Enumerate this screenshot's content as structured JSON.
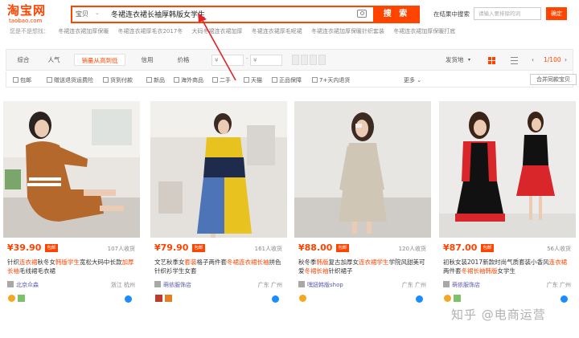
{
  "header": {
    "logo_cn": "淘宝网",
    "logo_en": "taobao.com",
    "search_scope": "宝贝",
    "search_query": "冬裙连衣裙长袖厚韩版女学生",
    "search_button": "搜 索",
    "within_label": "在结果中搜索",
    "within_placeholder": "请输入要排除的词",
    "within_button": "确定"
  },
  "hot_searches": {
    "label": "您是不是想找：",
    "items": [
      "冬裙连衣裙加厚保暖",
      "冬裙连衣裙厚毛衣2017冬",
      "大码冬裙连衣裙加厚",
      "冬裙连衣裙厚毛呢裙",
      "冬裙连衣裙加厚保暖针织套装",
      "冬裙连衣裙加厚保暖打底"
    ]
  },
  "toolbar": {
    "sorts": [
      "综合",
      "人气",
      "销量从高到低",
      "信用",
      "价格"
    ],
    "active_sort": "销量从高到低",
    "price_min": "¥",
    "price_max": "¥",
    "ship_from": "发货地",
    "page": "1/100",
    "prev": "‹",
    "next": "›"
  },
  "filters": {
    "checks": [
      "包邮",
      "赠送退货运费险",
      "货到付款",
      "新品",
      "海外商品",
      "二手",
      "天猫",
      "正品保障",
      "7+天内退货"
    ],
    "more": "更多",
    "compare": "合并同款宝贝"
  },
  "products": [
    {
      "price": "¥39.90",
      "tag": "包邮",
      "sold": "107人收货",
      "title_a": "针织",
      "title_h1": "连衣裙",
      "title_b": "秋冬女",
      "title_h2": "韩版学生",
      "title_c": "宽松大码中长款",
      "title_h3": "加厚长袖",
      "title_d": "毛线裙毛衣裙",
      "shop": "北京众森",
      "location": "浙江 杭州"
    },
    {
      "price": "¥79.90",
      "tag": "包邮",
      "sold": "161人收货",
      "title_a": "文艺秋季女",
      "title_h1": "套装",
      "title_b": "格子两件套",
      "title_h2": "冬裙连衣",
      "title_c": "",
      "title_h3": "裙长袖",
      "title_d": "拼色针织衫学生女套",
      "shop": "萌依服饰店",
      "location": "广东 广州"
    },
    {
      "price": "¥88.00",
      "tag": "包邮",
      "sold": "120人收货",
      "title_a": "秋冬季",
      "title_h1": "韩版",
      "title_b": "复古加厚女",
      "title_h2": "连衣裙学生",
      "title_c": "学院风甜美可爱",
      "title_h3": "冬裙长袖",
      "title_d": "针织裙子",
      "shop": "嘿妞韩版shop",
      "location": "广东 广州"
    },
    {
      "price": "¥87.00",
      "tag": "包邮",
      "sold": "56人收货",
      "title_a": "初秋女装2017新款时尚气质套装小香风",
      "title_h1": "连衣裙",
      "title_b": "两件套",
      "title_h2": "冬裙长袖",
      "title_c": "",
      "title_h3": "韩版",
      "title_d": "女学生",
      "shop": "萌依服饰店",
      "location": "广东 广州"
    }
  ],
  "watermark": "知乎 @电商运营",
  "colors": {
    "accent": "#ff4400",
    "toolbar_bg": "#f7f7f7"
  }
}
